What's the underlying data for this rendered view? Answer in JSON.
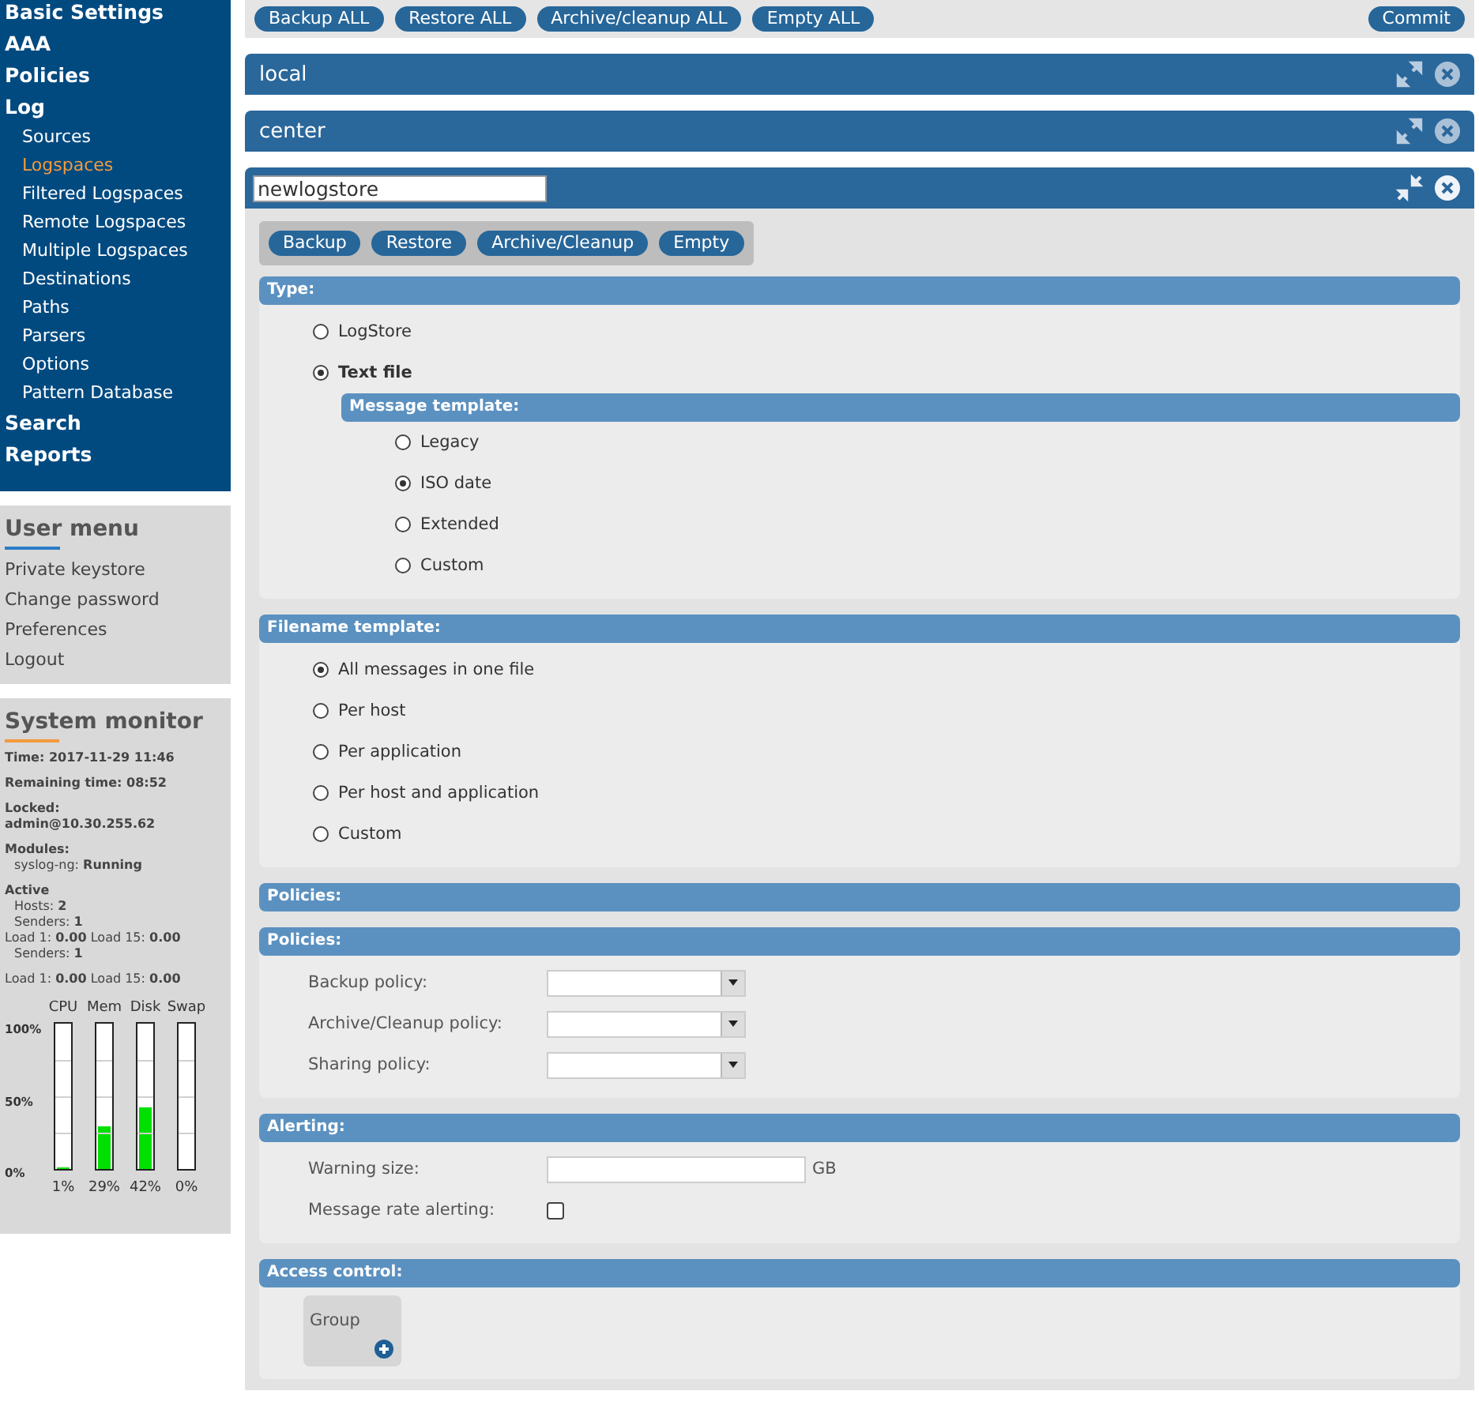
{
  "sidebar": {
    "nav": [
      {
        "label": "Basic Settings",
        "selected": false
      },
      {
        "label": "AAA",
        "selected": false
      },
      {
        "label": "Policies",
        "selected": false
      },
      {
        "label": "Log",
        "selected": false,
        "children": [
          {
            "label": "Sources",
            "selected": false
          },
          {
            "label": "Logspaces",
            "selected": true
          },
          {
            "label": "Filtered Logspaces",
            "selected": false
          },
          {
            "label": "Remote Logspaces",
            "selected": false
          },
          {
            "label": "Multiple Logspaces",
            "selected": false
          },
          {
            "label": "Destinations",
            "selected": false
          },
          {
            "label": "Paths",
            "selected": false
          },
          {
            "label": "Parsers",
            "selected": false
          },
          {
            "label": "Options",
            "selected": false
          },
          {
            "label": "Pattern Database",
            "selected": false
          }
        ]
      },
      {
        "label": "Search",
        "selected": false
      },
      {
        "label": "Reports",
        "selected": false
      }
    ]
  },
  "user_menu": {
    "title": "User menu",
    "items": [
      "Private keystore",
      "Change password",
      "Preferences",
      "Logout"
    ]
  },
  "system_monitor": {
    "title": "System monitor",
    "groups": [
      {
        "lines": [
          {
            "text": "**Time: 2017-11-29 11:46**",
            "indent": false
          }
        ]
      },
      {
        "lines": [
          {
            "text": "**Remaining time: 08:52**",
            "indent": false
          }
        ]
      },
      {
        "lines": [
          {
            "text": "**Locked:**",
            "indent": false
          },
          {
            "text": "**admin@10.30.255.62**",
            "indent": false
          }
        ]
      },
      {
        "lines": [
          {
            "text": "**Modules:**",
            "indent": false
          },
          {
            "text": "syslog-ng: **Running**",
            "indent": true
          }
        ]
      },
      {
        "lines": [
          {
            "text": "**Active**",
            "indent": false
          },
          {
            "text": "Hosts: **2**",
            "indent": true
          },
          {
            "text": "Senders: **1**",
            "indent": true
          },
          {
            "text": "Load 1: **0.00** Load 15: **0.00**",
            "indent": false
          },
          {
            "text": "Senders: **1**",
            "indent": true
          }
        ]
      },
      {
        "lines": [
          {
            "text": "Load 1: **0.00** Load 15: **0.00**",
            "indent": false
          }
        ]
      }
    ],
    "axis_labels": [
      "100%",
      "50%",
      "0%"
    ],
    "meters": [
      {
        "label": "CPU",
        "level": 0.01,
        "reading": "1%"
      },
      {
        "label": "Mem",
        "level": 0.29,
        "reading": "29%"
      },
      {
        "label": "Disk",
        "level": 0.42,
        "reading": "42%"
      },
      {
        "label": "Swap",
        "level": 0,
        "reading": "0%"
      }
    ]
  },
  "toolbar": {
    "buttons": [
      "Backup ALL",
      "Restore ALL",
      "Archive/cleanup ALL",
      "Empty ALL"
    ],
    "commit": "Commit"
  },
  "logspaces": [
    {
      "name": "local",
      "expanded": false
    },
    {
      "name": "center",
      "expanded": false
    },
    {
      "name": "newlogstore",
      "expanded": true
    }
  ],
  "editor": {
    "actions": [
      "Backup",
      "Restore",
      "Archive/Cleanup",
      "Empty"
    ],
    "sections": [
      {
        "kind": "radio",
        "title": "Type:",
        "options": [
          {
            "label": "LogStore",
            "selected": false
          },
          {
            "label": "Text file",
            "selected": true,
            "sub": {
              "title": "Message template:",
              "options": [
                {
                  "label": "Legacy",
                  "selected": false
                },
                {
                  "label": "ISO date",
                  "selected": true
                },
                {
                  "label": "Extended",
                  "selected": false
                },
                {
                  "label": "Custom",
                  "selected": false
                }
              ]
            }
          }
        ]
      },
      {
        "kind": "radio",
        "title": "Filename template:",
        "options": [
          {
            "label": "All messages in one file",
            "selected": true
          },
          {
            "label": "Per host",
            "selected": false
          },
          {
            "label": "Per application",
            "selected": false
          },
          {
            "label": "Per host and application",
            "selected": false
          },
          {
            "label": "Custom",
            "selected": false
          }
        ]
      },
      {
        "kind": "empty",
        "title": "Policies:"
      },
      {
        "kind": "selects",
        "title": "Policies:",
        "rows": [
          "Backup policy:",
          "Archive/Cleanup policy:",
          "Sharing policy:"
        ]
      },
      {
        "kind": "alerting",
        "title": "Alerting:",
        "size_label": "Warning size:",
        "unit": "GB",
        "rate_label": "Message rate alerting:",
        "rate_checked": false
      },
      {
        "kind": "access",
        "title": "Access control:",
        "group": "Group"
      }
    ]
  }
}
